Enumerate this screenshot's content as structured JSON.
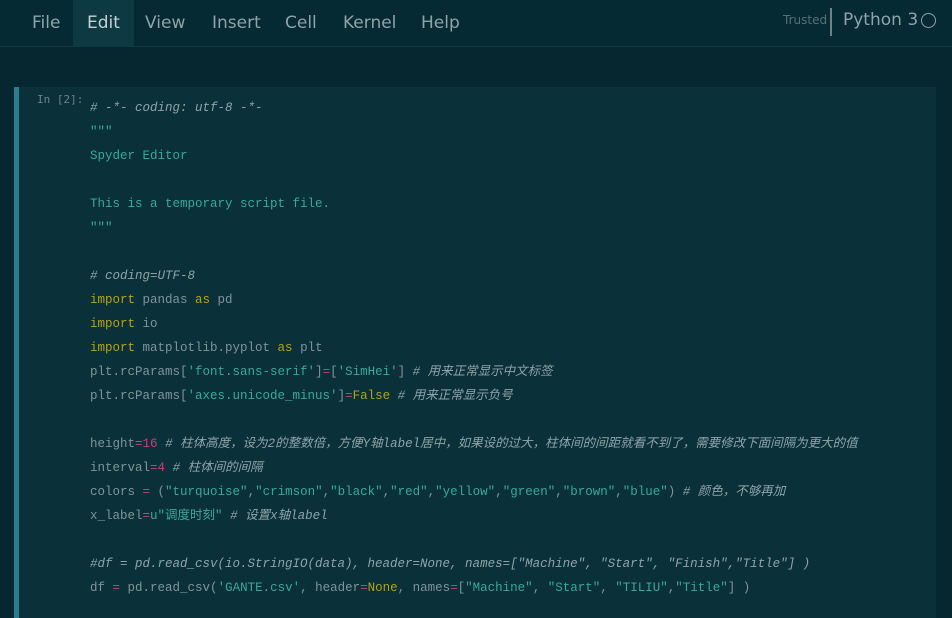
{
  "menu": {
    "items": [
      "File",
      "Edit",
      "View",
      "Insert",
      "Cell",
      "Kernel",
      "Help"
    ],
    "active": "Edit"
  },
  "status": {
    "trusted": "Trusted",
    "kernel": "Python 3"
  },
  "cell": {
    "prompt": "In [2]:",
    "lines": [
      [
        {
          "t": "cm",
          "v": "# -*- coding: utf-8 -*-"
        }
      ],
      [
        {
          "t": "str",
          "v": "\"\"\""
        }
      ],
      [
        {
          "t": "str",
          "v": "Spyder Editor"
        }
      ],
      [],
      [
        {
          "t": "str",
          "v": "This is a temporary script file."
        }
      ],
      [
        {
          "t": "str",
          "v": "\"\"\""
        }
      ],
      [],
      [
        {
          "t": "cm",
          "v": "# coding=UTF-8"
        }
      ],
      [
        {
          "t": "kw",
          "v": "import"
        },
        {
          "t": "n",
          "v": " pandas "
        },
        {
          "t": "kw",
          "v": "as"
        },
        {
          "t": "n",
          "v": " pd"
        }
      ],
      [
        {
          "t": "kw",
          "v": "import"
        },
        {
          "t": "n",
          "v": " io"
        }
      ],
      [
        {
          "t": "kw",
          "v": "import"
        },
        {
          "t": "n",
          "v": " matplotlib.pyplot "
        },
        {
          "t": "kw",
          "v": "as"
        },
        {
          "t": "n",
          "v": " plt"
        }
      ],
      [
        {
          "t": "n",
          "v": "plt.rcParams["
        },
        {
          "t": "str",
          "v": "'font.sans-serif'"
        },
        {
          "t": "n",
          "v": "]"
        },
        {
          "t": "op",
          "v": "="
        },
        {
          "t": "n",
          "v": "["
        },
        {
          "t": "str",
          "v": "'SimHei'"
        },
        {
          "t": "n",
          "v": "] "
        },
        {
          "t": "cm",
          "v": "# 用来正常显示中文标签"
        }
      ],
      [
        {
          "t": "n",
          "v": "plt.rcParams["
        },
        {
          "t": "str",
          "v": "'axes.unicode_minus'"
        },
        {
          "t": "n",
          "v": "]"
        },
        {
          "t": "op",
          "v": "="
        },
        {
          "t": "kw",
          "v": "False"
        },
        {
          "t": "n",
          "v": " "
        },
        {
          "t": "cm",
          "v": "# 用来正常显示负号"
        }
      ],
      [],
      [
        {
          "t": "n",
          "v": "height"
        },
        {
          "t": "op",
          "v": "="
        },
        {
          "t": "num",
          "v": "16"
        },
        {
          "t": "n",
          "v": " "
        },
        {
          "t": "cm",
          "v": "# 柱体高度，设为2的整数倍，方便Y轴label居中，如果设的过大，柱体间的间距就看不到了，需要修改下面间隔为更大的值"
        }
      ],
      [
        {
          "t": "n",
          "v": "interval"
        },
        {
          "t": "op",
          "v": "="
        },
        {
          "t": "num",
          "v": "4"
        },
        {
          "t": "n",
          "v": " "
        },
        {
          "t": "cm",
          "v": "# 柱体间的间隔"
        }
      ],
      [
        {
          "t": "n",
          "v": "colors "
        },
        {
          "t": "op",
          "v": "="
        },
        {
          "t": "n",
          "v": " ("
        },
        {
          "t": "str",
          "v": "\"turquoise\""
        },
        {
          "t": "n",
          "v": ","
        },
        {
          "t": "str",
          "v": "\"crimson\""
        },
        {
          "t": "n",
          "v": ","
        },
        {
          "t": "str",
          "v": "\"black\""
        },
        {
          "t": "n",
          "v": ","
        },
        {
          "t": "str",
          "v": "\"red\""
        },
        {
          "t": "n",
          "v": ","
        },
        {
          "t": "str",
          "v": "\"yellow\""
        },
        {
          "t": "n",
          "v": ","
        },
        {
          "t": "str",
          "v": "\"green\""
        },
        {
          "t": "n",
          "v": ","
        },
        {
          "t": "str",
          "v": "\"brown\""
        },
        {
          "t": "n",
          "v": ","
        },
        {
          "t": "str",
          "v": "\"blue\""
        },
        {
          "t": "n",
          "v": ") "
        },
        {
          "t": "cm",
          "v": "# 颜色，不够再加"
        }
      ],
      [
        {
          "t": "n",
          "v": "x_label"
        },
        {
          "t": "op",
          "v": "="
        },
        {
          "t": "str",
          "v": "u\"调度时刻\""
        },
        {
          "t": "n",
          "v": " "
        },
        {
          "t": "cm",
          "v": "# 设置x轴label"
        }
      ],
      [],
      [
        {
          "t": "cm",
          "v": "#df = pd.read_csv(io.StringIO(data), header=None, names=[\"Machine\", \"Start\", \"Finish\",\"Title\"] )"
        }
      ],
      [
        {
          "t": "n",
          "v": "df "
        },
        {
          "t": "op",
          "v": "="
        },
        {
          "t": "n",
          "v": " pd.read_csv("
        },
        {
          "t": "str",
          "v": "'GANTE.csv'"
        },
        {
          "t": "n",
          "v": ", header"
        },
        {
          "t": "op",
          "v": "="
        },
        {
          "t": "kw",
          "v": "None"
        },
        {
          "t": "n",
          "v": ", names"
        },
        {
          "t": "op",
          "v": "="
        },
        {
          "t": "n",
          "v": "["
        },
        {
          "t": "str",
          "v": "\"Machine\""
        },
        {
          "t": "n",
          "v": ", "
        },
        {
          "t": "str",
          "v": "\"Start\""
        },
        {
          "t": "n",
          "v": ", "
        },
        {
          "t": "str",
          "v": "\"TILIU\""
        },
        {
          "t": "n",
          "v": ","
        },
        {
          "t": "str",
          "v": "\"Title\""
        },
        {
          "t": "n",
          "v": "] )"
        }
      ]
    ]
  }
}
